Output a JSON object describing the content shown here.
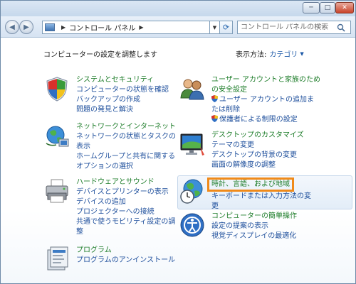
{
  "window": {
    "controls": {
      "minimize": "─",
      "maximize": "□",
      "close": "✕"
    }
  },
  "nav": {
    "address_root": "コントロール パネル",
    "search_placeholder": "コントロール パネルの検索"
  },
  "main": {
    "heading": "コンピューターの設定を調整します",
    "view_by_label": "表示方法:",
    "view_by_value": "カテゴリ"
  },
  "categories": [
    {
      "title": "システムとセキュリティ",
      "icon": "shield-icon",
      "links": [
        "コンピューターの状態を確認",
        "バックアップの作成",
        "問題の発見と解決"
      ]
    },
    {
      "title": "ネットワークとインターネット",
      "icon": "network-globe-icon",
      "links": [
        "ネットワークの状態とタスクの",
        "表示",
        "ホームグループと共有に関する",
        "オプションの選択"
      ]
    },
    {
      "title": "ハードウェアとサウンド",
      "icon": "printer-icon",
      "links": [
        "デバイスとプリンターの表示",
        "デバイスの追加",
        "プロジェクターへの接続",
        "共通で使うモビリティ設定の調",
        "整"
      ]
    },
    {
      "title": "プログラム",
      "icon": "programs-icon",
      "links": [
        "プログラムのアンインストール"
      ]
    },
    {
      "title": "ユーザー アカウントと家族のた",
      "title_cont": "め",
      "title_line2": "の安全設定",
      "icon": "users-icon",
      "links": [
        "ユーザー アカウントの追加ま",
        "たは削除",
        "保護者による制限の設定"
      ]
    },
    {
      "title": "デスクトップのカスタマイズ",
      "icon": "desktop-icon",
      "links": [
        "テーマの変更",
        "デスクトップの背景の変更",
        "画面の解像度の調整"
      ]
    },
    {
      "title": "時計、言語、および地域",
      "icon": "clock-globe-icon",
      "links": [
        "キーボードまたは入力方法の変",
        "更"
      ]
    },
    {
      "title": "コンピューターの簡単操作",
      "icon": "ease-of-access-icon",
      "links": [
        "設定の提案の表示",
        "視覚ディスプレイの最適化"
      ]
    }
  ],
  "colors": {
    "category_title": "#1e7d2a",
    "link": "#1e4f9c",
    "highlight_border": "#f08a1a"
  }
}
